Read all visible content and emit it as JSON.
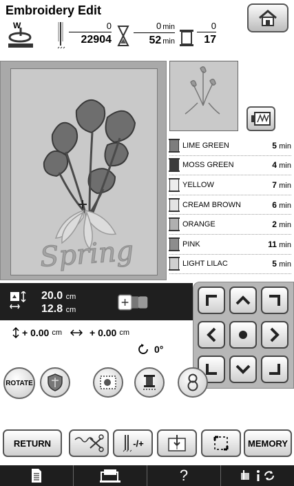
{
  "header": {
    "title": "Embroidery Edit",
    "presser_foot_label": "W",
    "stitch_current": "0",
    "stitch_total": "22904",
    "time_current": "0",
    "time_total": "52",
    "time_unit": "min",
    "color_current": "0",
    "color_total": "17"
  },
  "threads": [
    {
      "name": "LIME GREEN",
      "time": "5",
      "color": "#7d7d7d"
    },
    {
      "name": "MOSS GREEN",
      "time": "4",
      "color": "#3b3b3b"
    },
    {
      "name": "YELLOW",
      "time": "7",
      "color": "#ededed"
    },
    {
      "name": "CREAM BROWN",
      "time": "6",
      "color": "#e3e3e3"
    },
    {
      "name": "ORANGE",
      "time": "2",
      "color": "#b0b0b0"
    },
    {
      "name": "PINK",
      "time": "11",
      "color": "#8d8d8d"
    },
    {
      "name": "LIGHT LILAC",
      "time": "5",
      "color": "#cfcfcf"
    }
  ],
  "thread_time_unit": "min",
  "size": {
    "height": "20.0",
    "width": "12.8",
    "unit": "cm"
  },
  "offset": {
    "vertical": "+ 0.00",
    "horizontal": "+ 0.00",
    "unit": "cm",
    "angle": "0°"
  },
  "design_text": "Spring",
  "tools": {
    "rotate_label": "ROTATE"
  },
  "buttons": {
    "return_label": "RETURN",
    "density_label": "-/+",
    "memory_label": "MEMORY"
  },
  "bottom_bar": {
    "help_label": "?"
  },
  "icons": {
    "home": "home-icon",
    "presser": "presser-foot-icon",
    "needle": "needle-icon",
    "hourglass": "hourglass-icon",
    "spool": "thread-spool-icon",
    "view": "view-icon",
    "size": "size-icon",
    "layout": "hoop-layout-icon",
    "rotate": "rotate-icon",
    "shield": "shield-icon",
    "density": "density-icon",
    "thread": "thread-icon",
    "eight": "eight-icon"
  }
}
